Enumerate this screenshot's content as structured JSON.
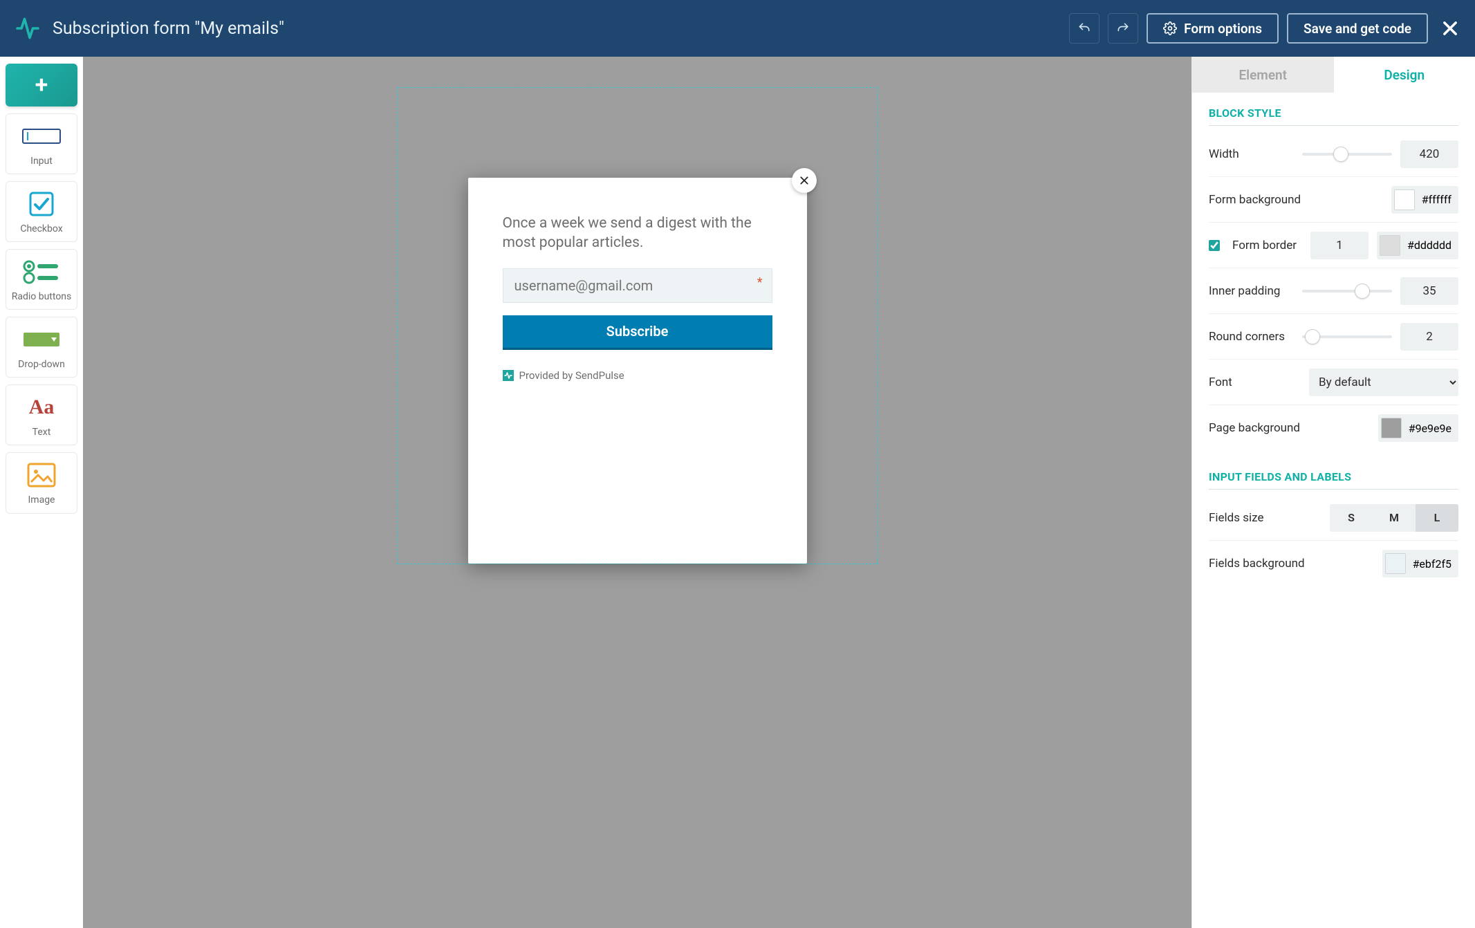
{
  "header": {
    "title": "Subscription form \"My emails\"",
    "form_options_label": "Form options",
    "save_label": "Save and get code"
  },
  "toolbox": {
    "add_label": "+",
    "items": [
      {
        "label": "Input"
      },
      {
        "label": "Checkbox"
      },
      {
        "label": "Radio buttons"
      },
      {
        "label": "Drop-down"
      },
      {
        "label": "Text"
      },
      {
        "label": "Image"
      }
    ]
  },
  "form_preview": {
    "heading": "Once a week we send a digest with the most popular articles.",
    "email_placeholder": "username@gmail.com",
    "subscribe_label": "Subscribe",
    "provided_label": "Provided by SendPulse"
  },
  "right_panel": {
    "tabs": {
      "element": "Element",
      "design": "Design"
    },
    "block_style_title": "BLOCK STYLE",
    "input_section_title": "INPUT FIELDS AND LABELS",
    "props": {
      "width": {
        "label": "Width",
        "value": "420"
      },
      "form_background": {
        "label": "Form background",
        "value": "#ffffff",
        "swatch": "#ffffff"
      },
      "form_border": {
        "label": "Form border",
        "checked": true,
        "width": "1",
        "color": "#dddddd",
        "swatch": "#dddddd"
      },
      "inner_padding": {
        "label": "Inner padding",
        "value": "35"
      },
      "round_corners": {
        "label": "Round corners",
        "value": "2"
      },
      "font": {
        "label": "Font",
        "value": "By default"
      },
      "page_background": {
        "label": "Page background",
        "value": "#9e9e9e",
        "swatch": "#9e9e9e"
      },
      "fields_size": {
        "label": "Fields size",
        "options": [
          "S",
          "M",
          "L"
        ],
        "active": "L"
      },
      "fields_background": {
        "label": "Fields background",
        "value": "#ebf2f5",
        "swatch": "#ebf2f5"
      }
    }
  }
}
